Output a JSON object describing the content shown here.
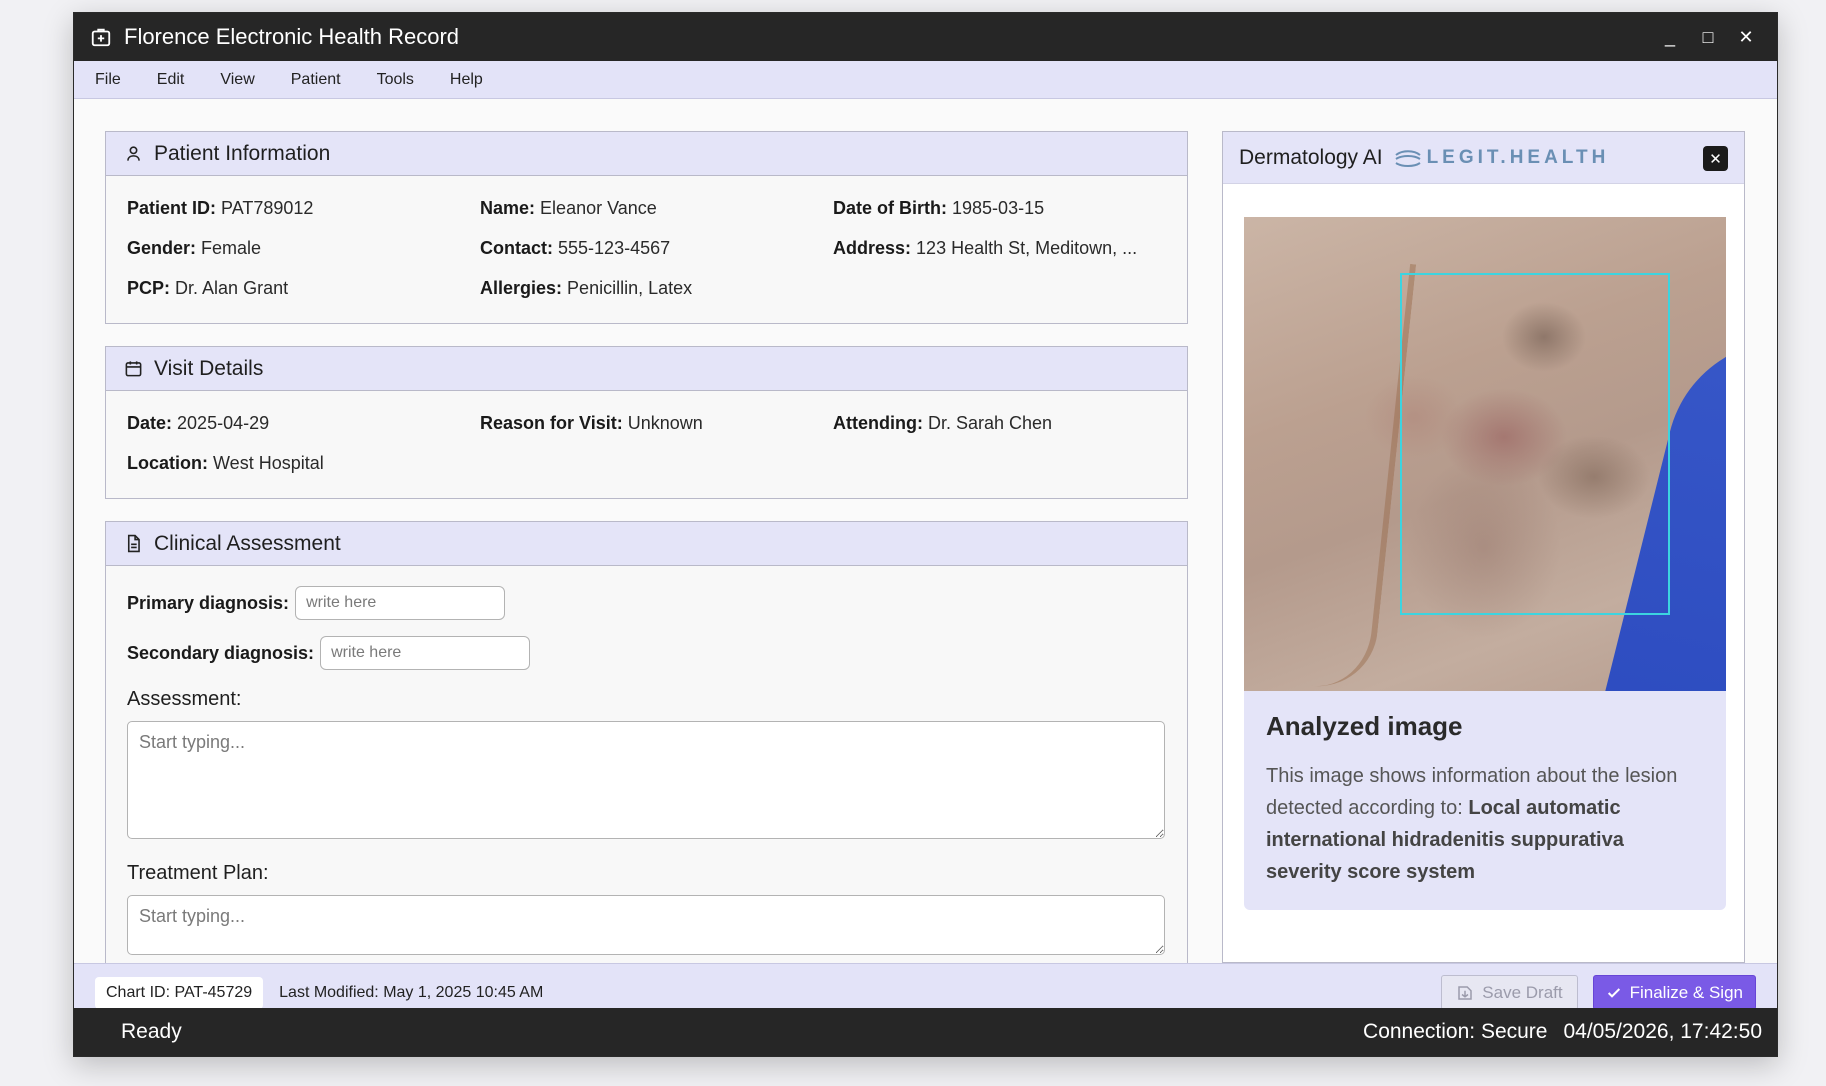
{
  "window": {
    "title": "Florence Electronic Health Record",
    "controls": {
      "minimize": "_",
      "maximize": "□",
      "close": "✕"
    }
  },
  "menu": [
    "File",
    "Edit",
    "View",
    "Patient",
    "Tools",
    "Help"
  ],
  "patient_info": {
    "title": "Patient Information",
    "icon": "user-icon",
    "fields": [
      {
        "label": "Patient ID:",
        "value": "PAT789012"
      },
      {
        "label": "Name:",
        "value": "Eleanor Vance"
      },
      {
        "label": "Date of Birth:",
        "value": "1985-03-15"
      },
      {
        "label": "Gender:",
        "value": "Female"
      },
      {
        "label": "Contact:",
        "value": "555-123-4567"
      },
      {
        "label": "Address:",
        "value": "123 Health St, Meditown, ..."
      },
      {
        "label": "PCP:",
        "value": "Dr. Alan Grant"
      },
      {
        "label": "Allergies:",
        "value": "Penicillin, Latex"
      }
    ]
  },
  "visit_details": {
    "title": "Visit Details",
    "icon": "calendar-icon",
    "fields": [
      {
        "label": "Date:",
        "value": "2025-04-29"
      },
      {
        "label": "Reason for Visit:",
        "value": "Unknown"
      },
      {
        "label": "Attending:",
        "value": "Dr. Sarah Chen"
      },
      {
        "label": "Location:",
        "value": "West Hospital"
      }
    ]
  },
  "clinical": {
    "title": "Clinical Assessment",
    "icon": "document-icon",
    "primary_label": "Primary diagnosis:",
    "primary_placeholder": "write here",
    "primary_value": "",
    "secondary_label": "Secondary diagnosis:",
    "secondary_placeholder": "write here",
    "secondary_value": "",
    "assessment_label": "Assessment:",
    "assessment_placeholder": "Start typing...",
    "treatment_label": "Treatment Plan:",
    "treatment_placeholder": "Start typing..."
  },
  "derm_panel": {
    "title": "Dermatology AI",
    "brand": "LEGIT.HEALTH",
    "close": "✕",
    "caption_title": "Analyzed image",
    "caption_text": "This image shows information about the lesion detected according to: ",
    "caption_bold": "Local automatic international hidradenitis suppurativa severity score system",
    "colors": {
      "bbox": "#3cd4e0"
    }
  },
  "footer": {
    "chart_id": "Chart ID: PAT-45729",
    "last_modified": "Last Modified: May 1, 2025 10:45 AM",
    "save_draft": "Save Draft",
    "finalize": "Finalize & Sign",
    "accent": "#7a5ae6"
  },
  "status": {
    "state": "Ready",
    "connection": "Connection: Secure",
    "datetime": "04/05/2026, 17:42:50"
  }
}
